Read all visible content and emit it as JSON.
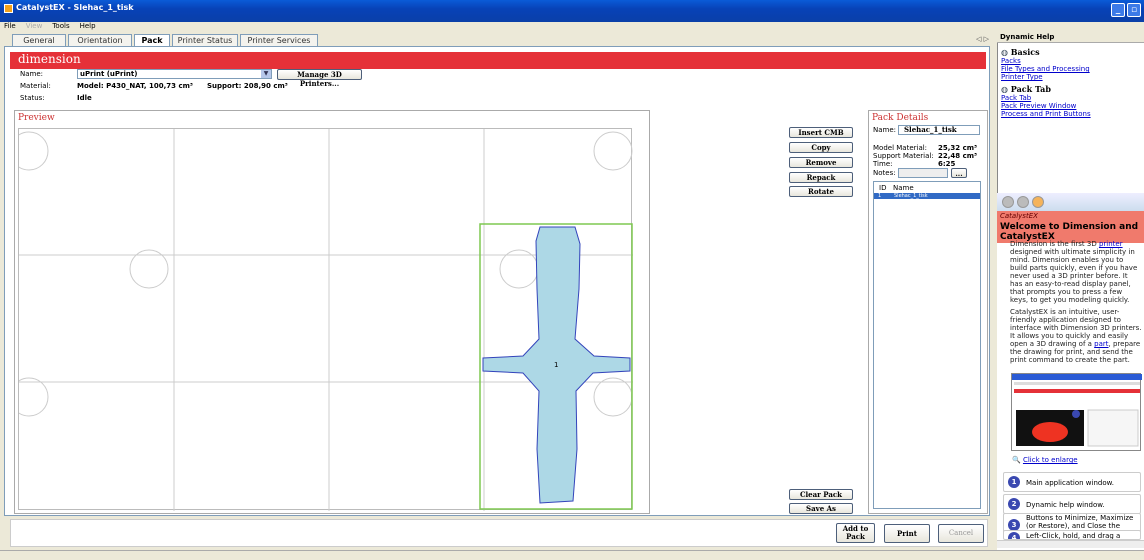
{
  "window": {
    "title": "CatalystEX - Slehac_1_tisk"
  },
  "menu": [
    "File",
    "View",
    "Tools",
    "Help"
  ],
  "tabs": [
    {
      "label": "General"
    },
    {
      "label": "Orientation"
    },
    {
      "label": "Pack"
    },
    {
      "label": "Printer Status"
    },
    {
      "label": "Printer Services"
    }
  ],
  "brand": {
    "logo": "dimension"
  },
  "printer": {
    "name_label": "Name:",
    "name_value": "uPrint (uPrint)",
    "manage_button": "Manage 3D Printers...",
    "material_label": "Material:",
    "material_value": "Model: P430_NAT, 100,73 cm³",
    "support_value": "Support: 208,90 cm³",
    "status_label": "Status:",
    "status_value": "Idle"
  },
  "preview": {
    "title": "Preview",
    "part_label": "1"
  },
  "actions": [
    "Insert CMB",
    "Copy",
    "Remove",
    "Repack",
    "Rotate"
  ],
  "bottom_actions": [
    "Clear Pack",
    "Save As"
  ],
  "pack_details": {
    "title": "Pack Details",
    "name_label": "Name:",
    "name_value": "Slehac_1_tisk",
    "model_label": "Model Material:",
    "model_value": "25,32 cm³",
    "support_label": "Support Material:",
    "support_value": "22,48 cm³",
    "time_label": "Time:",
    "time_value": "6:25",
    "notes_label": "Notes:",
    "notes_button": "...",
    "col_id": "ID",
    "col_name": "Name",
    "row_id": "1",
    "row_name": "Slehac_1_tisk"
  },
  "footer": {
    "add_to_pack": "Add to Pack",
    "print": "Print",
    "cancel": "Cancel"
  },
  "help": {
    "header": "Dynamic Help",
    "basics_title": "Basics",
    "basics_links": [
      "Packs",
      "File Types and Processing",
      "Printer Type"
    ],
    "pack_title": "Pack Tab",
    "pack_links": [
      "Pack Tab",
      "Pack Preview Window",
      "Process and Print Buttons"
    ]
  },
  "welcome": {
    "brand": "CatalystEX",
    "title": "Welcome to Dimension and CatalystEX",
    "p1_a": "Dimension is the first 3D ",
    "p1_link": "printer",
    "p1_b": " designed with ultimate simplicity in mind. Dimension enables you to build parts quickly, even if you have never used a 3D printer before. It has an easy-to-read display panel, that prompts you to press a few keys, to get you modeling quickly.",
    "p2_a": "CatalystEX is an intuitive, user-friendly application designed to interface with Dimension 3D printers. It allows you to quickly and easily open a 3D drawing of a ",
    "p2_link": "part",
    "p2_b": ", prepare the drawing for print, and send the print command to create the part.",
    "enlarge": "Click to enlarge",
    "steps": [
      {
        "n": "1",
        "text": "Main application window."
      },
      {
        "n": "2",
        "text": "Dynamic help window."
      },
      {
        "n": "3",
        "text": "Buttons to Minimize, Maximize (or Restore), and Close the CatalystEX window."
      },
      {
        "n": "4",
        "text": "Left-Click, hold, and drag a"
      }
    ]
  },
  "colors": {
    "accent": "#e53138",
    "part_fill": "#add8e6",
    "selection": "#316ac5",
    "pack_border": "#7ec850"
  }
}
